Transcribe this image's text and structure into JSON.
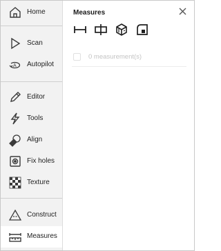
{
  "sidebar": {
    "items": [
      {
        "label": "Home",
        "icon": "home-icon"
      },
      {
        "label": "Scan",
        "icon": "play-triangle-icon"
      },
      {
        "label": "Autopilot",
        "icon": "autopilot-rotate-icon"
      },
      {
        "label": "Editor",
        "icon": "pencil-icon"
      },
      {
        "label": "Tools",
        "icon": "lightning-icon"
      },
      {
        "label": "Align",
        "icon": "align-shapes-icon"
      },
      {
        "label": "Fix holes",
        "icon": "fix-holes-icon"
      },
      {
        "label": "Texture",
        "icon": "checker-texture-icon"
      },
      {
        "label": "Construct",
        "icon": "triangle-construct-icon"
      },
      {
        "label": "Measures",
        "icon": "ruler-icon"
      }
    ],
    "active": "Measures"
  },
  "panel": {
    "title": "Measures",
    "tools": [
      "distance-measure-icon",
      "caliper-measure-icon",
      "volume-cube-icon",
      "area-measure-icon"
    ],
    "measurement_count_text": "0 measurement(s)"
  },
  "colors": {
    "sidebar_bg": "#f2f2f2",
    "active_bg": "#ffffff",
    "icon_stroke": "#3a3a3a",
    "muted_text": "#c4c4c4"
  }
}
